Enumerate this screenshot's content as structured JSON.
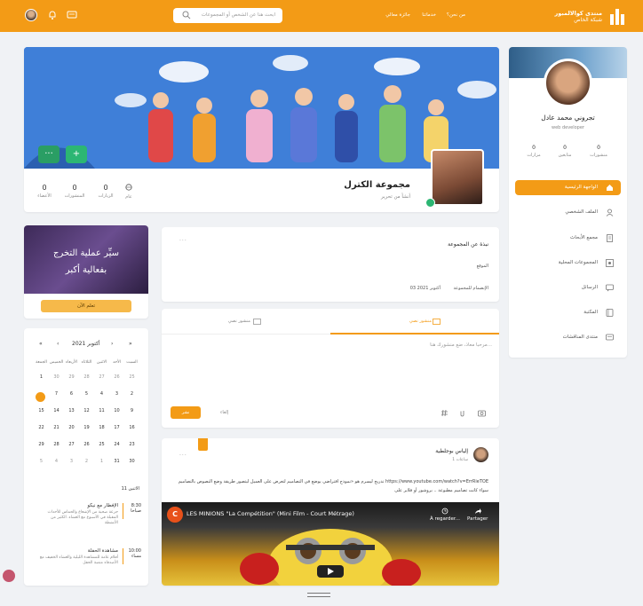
{
  "header": {
    "brand_title": "منتدى كوالالمبور",
    "brand_subtitle": "شبكة الخاص",
    "nav": [
      "من نحن؟",
      "خدماتنا",
      "جائزة معالي"
    ],
    "search_placeholder": "ابحث هنا عن الشخص أو المجموعات"
  },
  "group": {
    "name": "مجموعة الكترل",
    "subtitle": "أنشأ من تحرير",
    "stats": [
      {
        "value": "عام",
        "label": "عام",
        "icon": "globe-icon"
      },
      {
        "value": "0",
        "label": "الزيارات"
      },
      {
        "value": "0",
        "label": "المنشورات"
      },
      {
        "value": "0",
        "label": "الأعضاء"
      }
    ],
    "add_label": "+",
    "more_label": "···"
  },
  "profile": {
    "name": "تجروني محمد عادل",
    "role": "web developer",
    "stats": [
      {
        "value": "0",
        "label": "منشورات"
      },
      {
        "value": "0",
        "label": "متابعين"
      },
      {
        "value": "0",
        "label": "مزارات"
      }
    ],
    "menu": [
      {
        "label": "الواجهة الرئيسية",
        "icon": "home-icon",
        "active": true
      },
      {
        "label": "الملف الشخصي",
        "icon": "user-icon"
      },
      {
        "label": "مجمع الأبحاث",
        "icon": "document-icon"
      },
      {
        "label": "المجموعات المحلية",
        "icon": "groups-icon"
      },
      {
        "label": "الرسائل",
        "icon": "chat-icon"
      },
      {
        "label": "المكتبة",
        "icon": "book-icon"
      },
      {
        "label": "منتدى المناقشات",
        "icon": "forum-icon"
      }
    ]
  },
  "ad": {
    "text_line1": "سيِّر عملية التخرج",
    "text_line2": "بفعالية أكبر",
    "button": "تعلم الآن"
  },
  "calendar": {
    "month": "أكتوبر 2021",
    "prev_year": "«",
    "prev": "‹",
    "next": "›",
    "next_year": "»",
    "weekdays": [
      "السبت",
      "الأحد",
      "الاثنين",
      "الثلاثاء",
      "الأربعاء",
      "الخميس",
      "الجمعة"
    ],
    "weeks": [
      [
        "25",
        "26",
        "27",
        "28",
        "29",
        "30",
        "1"
      ],
      [
        "2",
        "3",
        "4",
        "5",
        "6",
        "7",
        "8"
      ],
      [
        "9",
        "10",
        "11",
        "12",
        "13",
        "14",
        "15"
      ],
      [
        "16",
        "17",
        "18",
        "19",
        "20",
        "21",
        "22"
      ],
      [
        "23",
        "24",
        "25",
        "26",
        "27",
        "28",
        "29"
      ],
      [
        "30",
        "31",
        "1",
        "2",
        "3",
        "4",
        "5"
      ]
    ],
    "today": "8",
    "event_date": "الاثنين 11",
    "events": [
      {
        "time": "8:30 صباحا",
        "title": "الإفطار مع نيكو",
        "desc": "جرعة صحية من الإشعاع والحماس للأحداث المقبلة في الأسبوع مع العشاء. الكثير من الأنشطة"
      },
      {
        "time": "10:00 مساء",
        "title": "مشاهدة الحفلة",
        "desc": "أفلام عامة للمشاهدة الليلية والعشاء الخفيف مع الأصدقاء منصة الحفل"
      }
    ]
  },
  "about": {
    "title": "نبذة عن المجموعة",
    "location_label": "الموقع",
    "joined_label": "الإنضمام للمجموعة",
    "joined_value": "03 أكتوبر 2021",
    "more": "···"
  },
  "composer": {
    "tab_post": "منشور نصي",
    "tab_media": "منشور نصي",
    "placeholder": "مرحبا معاذ، ضع منشورك هنا...",
    "post_button": "نشر",
    "cancel": "إلغاء"
  },
  "post": {
    "author": "إلياس بوجلطية",
    "time": "1 ساعات",
    "line1": "تدريج ليسرم هو «نموذج افتراضي يوضع في التصاميم لتعرض على العميل ليتصور طريقة وضع النصوص بالتصاميم https://www.youtube.com/watch?v=ErrRieTOE",
    "line2": "سواء كانت تصاميم مطبوعة .. بروشور أو فلاير على",
    "more": "···",
    "video_title": "LES MINIONS \"La Compétition\" (Mini Film - Court Métrage)",
    "video_channel_initial": "C",
    "video_action1": "À regarder...",
    "video_action2": "Partager"
  },
  "colors": {
    "accent": "#f39b16",
    "success": "#2cb673"
  }
}
